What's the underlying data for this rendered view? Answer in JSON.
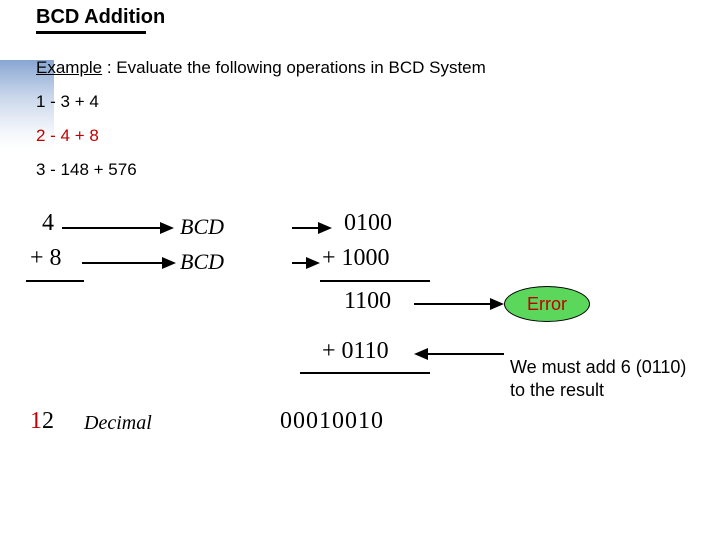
{
  "title": "BCD Addition",
  "example_label": "Example",
  "example_rest": " : Evaluate the following operations in BCD System",
  "items": {
    "i1": "1 - 3 + 4",
    "i2": "2 - 4 + 8",
    "i3": "3 - 148 + 576"
  },
  "math": {
    "lhs_4": "4",
    "plus8": "+ 8",
    "twelve_1": "1",
    "twelve_2": "2",
    "decimal_label": "Decimal",
    "bcd_label": "BCD",
    "bin0100": "0100",
    "binplus1000": "+ 1000",
    "bin1100": "1100",
    "binplus0110": "+ 0110",
    "bin00010010": "00010010"
  },
  "error_label": "Error",
  "note_text": "We must add 6 (0110) to the result"
}
